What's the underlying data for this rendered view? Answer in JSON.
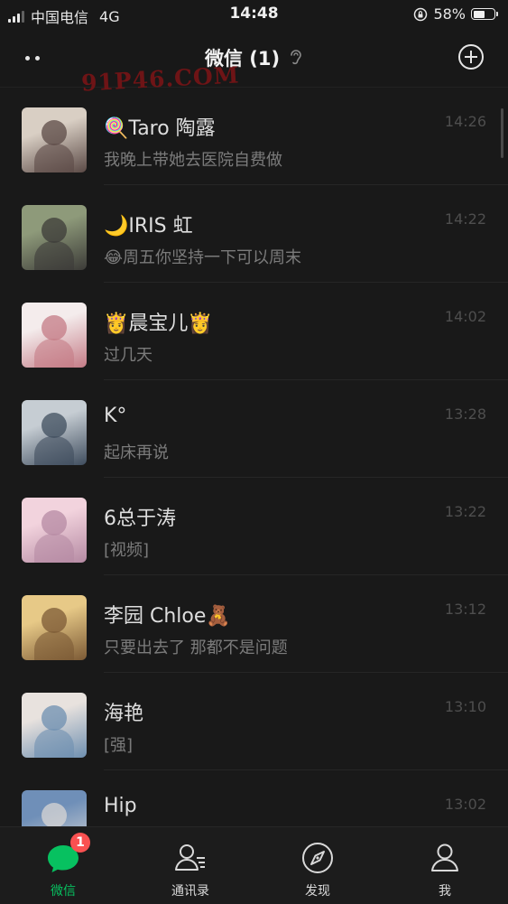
{
  "status_bar": {
    "carrier": "中国电信",
    "network": "4G",
    "time": "14:48",
    "battery": "58%",
    "battery_level": 0.58
  },
  "header": {
    "title": "微信 (1)",
    "watermark": "91P46.COM"
  },
  "chats": [
    {
      "name": "🍭Taro 陶露",
      "message": "我晚上带她去医院自费做",
      "time": "14:26",
      "avatar_colors": [
        "#d9cfc4",
        "#5b4a46"
      ]
    },
    {
      "name": "🌙IRIS 虹",
      "message": "😂周五你坚持一下可以周末",
      "time": "14:22",
      "avatar_colors": [
        "#8e9a7a",
        "#3c3b38"
      ]
    },
    {
      "name": "👸晨宝儿👸",
      "message": "过几天",
      "time": "14:02",
      "avatar_colors": [
        "#f4ecec",
        "#c47b86"
      ]
    },
    {
      "name": "K°",
      "message": "起床再说",
      "time": "13:28",
      "avatar_colors": [
        "#c6cdd3",
        "#3f4d5e"
      ]
    },
    {
      "name": "6总于涛",
      "message": "[视频]",
      "time": "13:22",
      "avatar_colors": [
        "#f2d3dd",
        "#b58aa3"
      ]
    },
    {
      "name": "李园 Chloe🧸",
      "message": "只要出去了  那都不是问题",
      "time": "13:12",
      "avatar_colors": [
        "#e7c987",
        "#7c5a35"
      ]
    },
    {
      "name": "海艳",
      "message": "[强]",
      "time": "13:10",
      "avatar_colors": [
        "#e8e2de",
        "#6e8fb0"
      ]
    },
    {
      "name": "Hip",
      "message": "",
      "time": "13:02",
      "avatar_colors": [
        "#6f8fb8",
        "#d8d6d4"
      ]
    }
  ],
  "tabs": [
    {
      "label": "微信",
      "badge": "1",
      "icon": "chat-bubble-icon"
    },
    {
      "label": "通讯录",
      "icon": "contacts-icon"
    },
    {
      "label": "发现",
      "icon": "compass-icon"
    },
    {
      "label": "我",
      "icon": "person-icon"
    }
  ],
  "colors": {
    "accent": "#07c160",
    "badge": "#fa5151",
    "background": "#191919"
  }
}
